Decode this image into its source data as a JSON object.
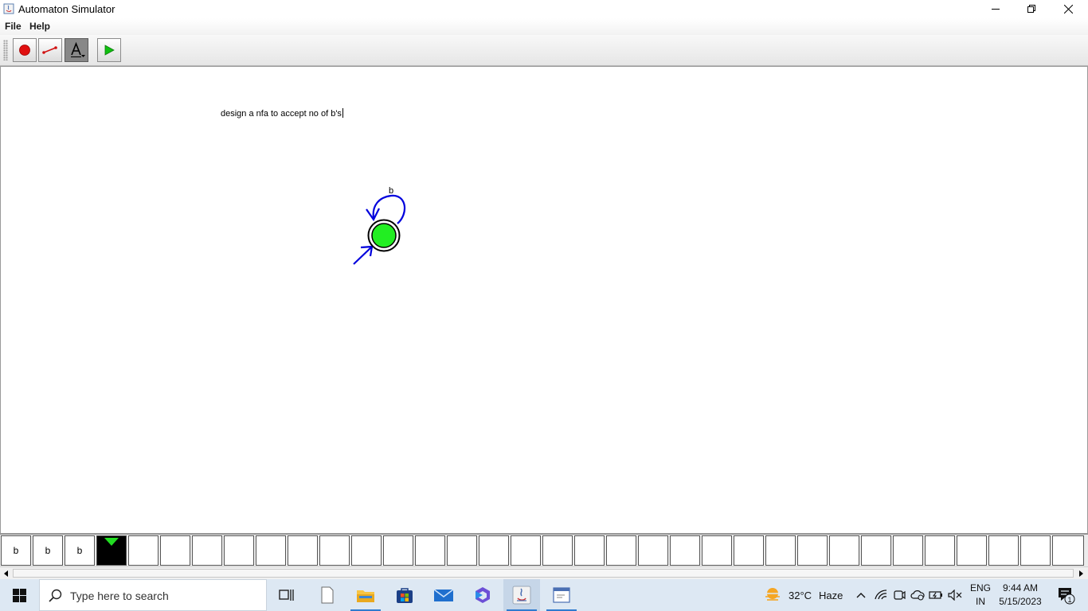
{
  "window": {
    "title": "Automaton Simulator"
  },
  "menu": {
    "items": [
      "File",
      "Help"
    ]
  },
  "toolbar": {
    "tools": [
      {
        "name": "state-tool",
        "icon": "red-dot-icon"
      },
      {
        "name": "transition-tool",
        "icon": "arrow-line-icon"
      },
      {
        "name": "text-tool",
        "icon": "text-a-icon",
        "selected": true
      },
      {
        "name": "run-tool",
        "icon": "play-icon"
      }
    ]
  },
  "canvas": {
    "note": "design a nfa to accept no of b's",
    "transition_label": "b"
  },
  "tape": {
    "symbols": [
      "b",
      "b",
      "b"
    ],
    "head_index": 3
  },
  "taskbar": {
    "search_placeholder": "Type here to search",
    "weather": {
      "temp": "32°C",
      "condition": "Haze"
    },
    "language": {
      "line1": "ENG",
      "line2": "IN"
    },
    "clock": {
      "time": "9:44 AM",
      "date": "5/15/2023"
    },
    "notifications": "1"
  }
}
